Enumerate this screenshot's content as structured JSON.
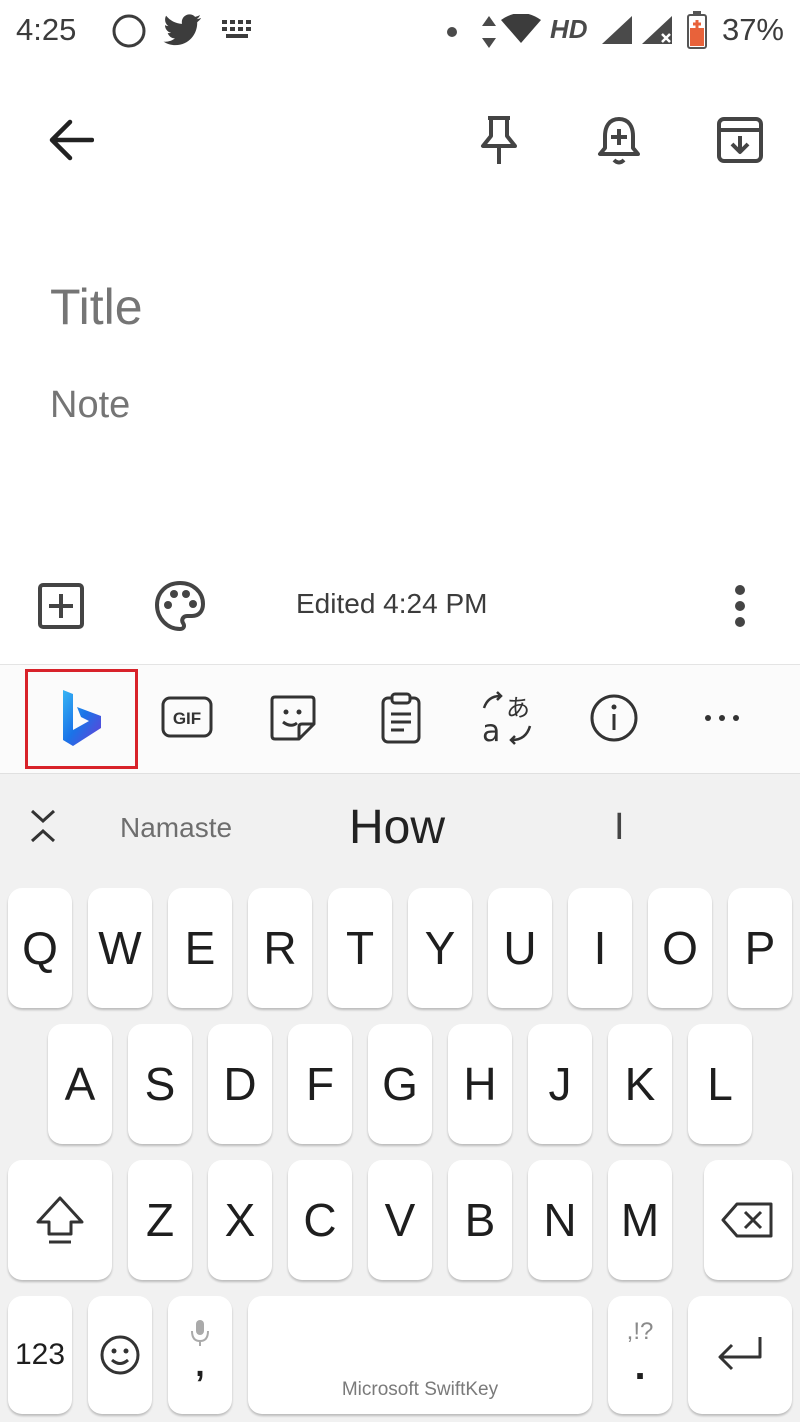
{
  "status_bar": {
    "time": "4:25",
    "network": "HD",
    "battery_percent": "37%"
  },
  "top_bar": {
    "back_icon": "arrow-back-icon",
    "pin_icon": "pin-icon",
    "reminder_icon": "bell-plus-icon",
    "archive_icon": "archive-icon"
  },
  "note": {
    "title_placeholder": "Title",
    "note_placeholder": "Note"
  },
  "bottom_bar": {
    "edited_text": "Edited 4:24 PM"
  },
  "keyboard_toolbar": {
    "items": [
      "bing-icon",
      "gif-icon",
      "sticker-icon",
      "clipboard-icon",
      "translate-icon",
      "info-icon",
      "more-icon"
    ],
    "gif_label": "GIF",
    "highlight_color": "#d8222a"
  },
  "suggestions": {
    "left": "Namaste",
    "center": "How",
    "right": "I"
  },
  "keyboard": {
    "row1": [
      "Q",
      "W",
      "E",
      "R",
      "T",
      "Y",
      "U",
      "I",
      "O",
      "P"
    ],
    "row2": [
      "A",
      "S",
      "D",
      "F",
      "G",
      "H",
      "J",
      "K",
      "L"
    ],
    "row3": [
      "Z",
      "X",
      "C",
      "V",
      "B",
      "N",
      "M"
    ],
    "numbers_label": "123",
    "space_label": "Microsoft SwiftKey",
    "comma_label": ",",
    "period_label": ".",
    "punct_hint": ",!?"
  }
}
